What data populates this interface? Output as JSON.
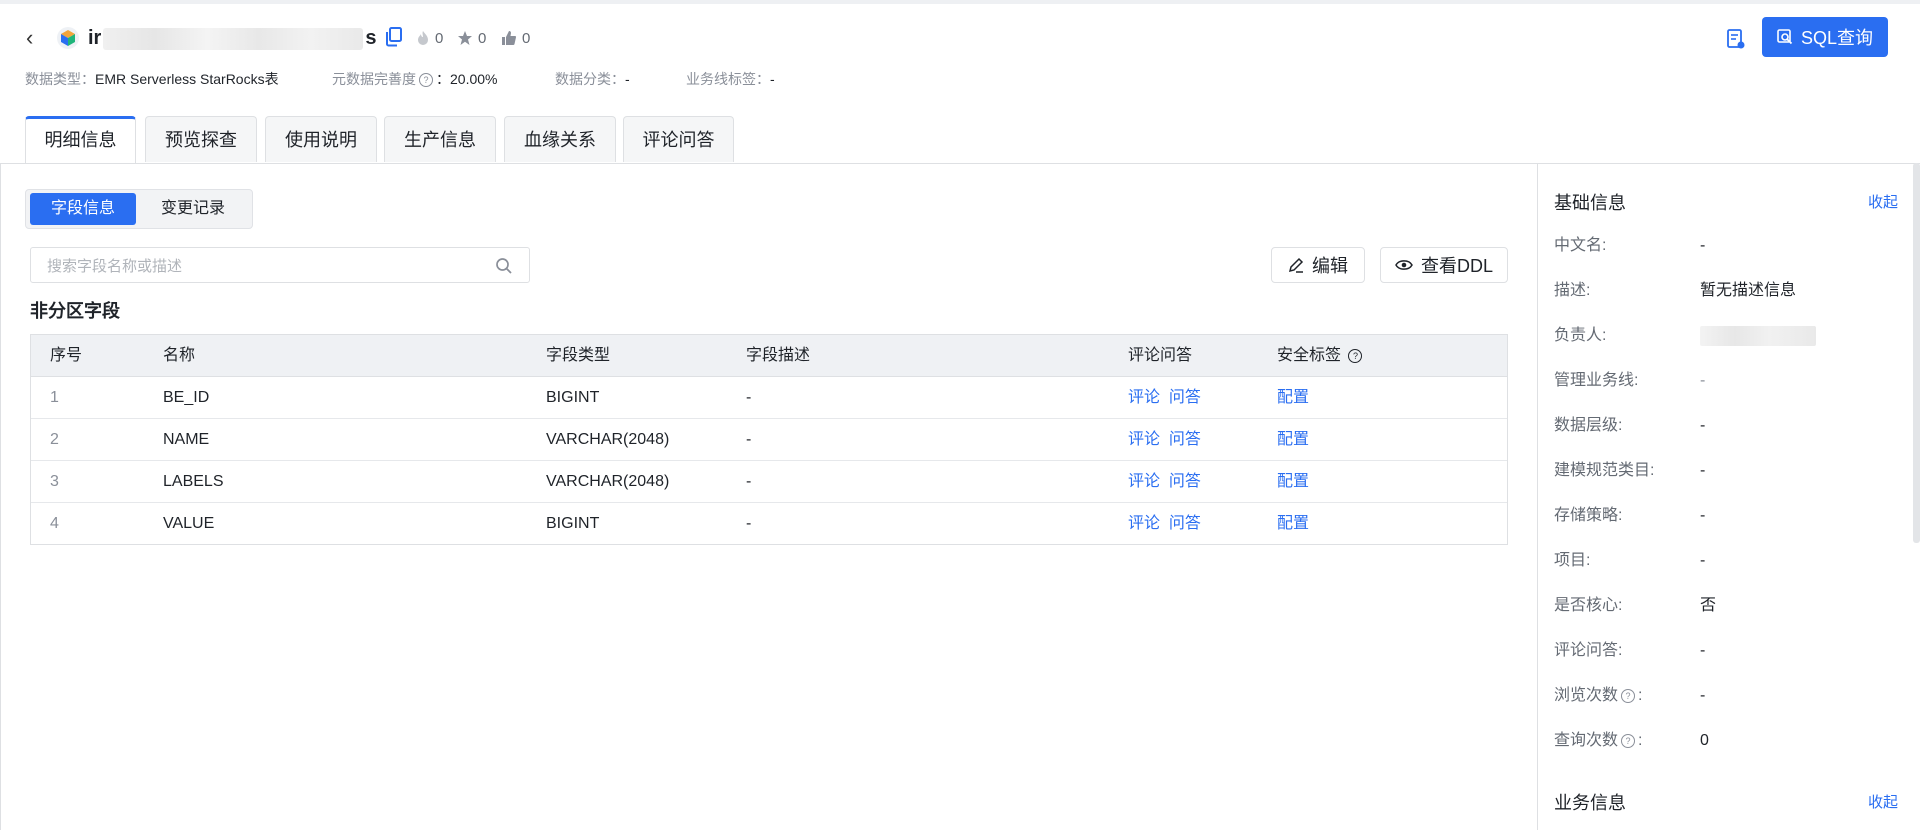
{
  "header": {
    "title_prefix": "ir",
    "title_suffix": "s",
    "hot_count": "0",
    "star_count": "0",
    "like_count": "0",
    "sql_button": "SQL查询",
    "meta": [
      {
        "key": "数据类型：",
        "value": "EMR Serverless StarRocks表"
      },
      {
        "key": "元数据完善度",
        "value": "：20.00%"
      },
      {
        "key": "数据分类：",
        "value": "-"
      },
      {
        "key": "业务线标签：",
        "value": "-"
      }
    ]
  },
  "tabs": [
    "明细信息",
    "预览探查",
    "使用说明",
    "生产信息",
    "血缘关系",
    "评论问答"
  ],
  "segment": [
    "字段信息",
    "变更记录"
  ],
  "search": {
    "placeholder": "搜索字段名称或描述"
  },
  "actions": {
    "edit": "编辑",
    "ddl": "查看DDL"
  },
  "section_title": "非分区字段",
  "table": {
    "headers": [
      "序号",
      "名称",
      "字段类型",
      "字段描述",
      "评论问答",
      "安全标签"
    ],
    "rows": [
      {
        "idx": "1",
        "name": "BE_ID",
        "type": "BIGINT",
        "desc": "-"
      },
      {
        "idx": "2",
        "name": "NAME",
        "type": "VARCHAR(2048)",
        "desc": "-"
      },
      {
        "idx": "3",
        "name": "LABELS",
        "type": "VARCHAR(2048)",
        "desc": "-"
      },
      {
        "idx": "4",
        "name": "VALUE",
        "type": "BIGINT",
        "desc": "-"
      }
    ],
    "comment_link": "评论",
    "qa_link": "问答",
    "config_link": "配置"
  },
  "sidebar": {
    "basic_title": "基础信息",
    "collapse": "收起",
    "fields": [
      {
        "k": "中文名:",
        "v": "-"
      },
      {
        "k": "描述:",
        "v": "暂无描述信息"
      },
      {
        "k": "负责人:",
        "v": ""
      },
      {
        "k": "管理业务线:",
        "v": "-"
      },
      {
        "k": "数据层级:",
        "v": "-"
      },
      {
        "k": "建模规范类目:",
        "v": "-"
      },
      {
        "k": "存储策略:",
        "v": "-"
      },
      {
        "k": "项目:",
        "v": "-"
      },
      {
        "k": "是否核心:",
        "v": "否"
      },
      {
        "k": "评论问答:",
        "v": "-"
      },
      {
        "k": "浏览次数",
        "v": "-"
      },
      {
        "k": "查询次数",
        "v": "0"
      }
    ],
    "biz_title": "业务信息",
    "biz_collapse": "收起"
  },
  "colors": {
    "accent": "#2a6ef1",
    "border": "#dee0e3",
    "header_bg": "#eff1f4"
  }
}
